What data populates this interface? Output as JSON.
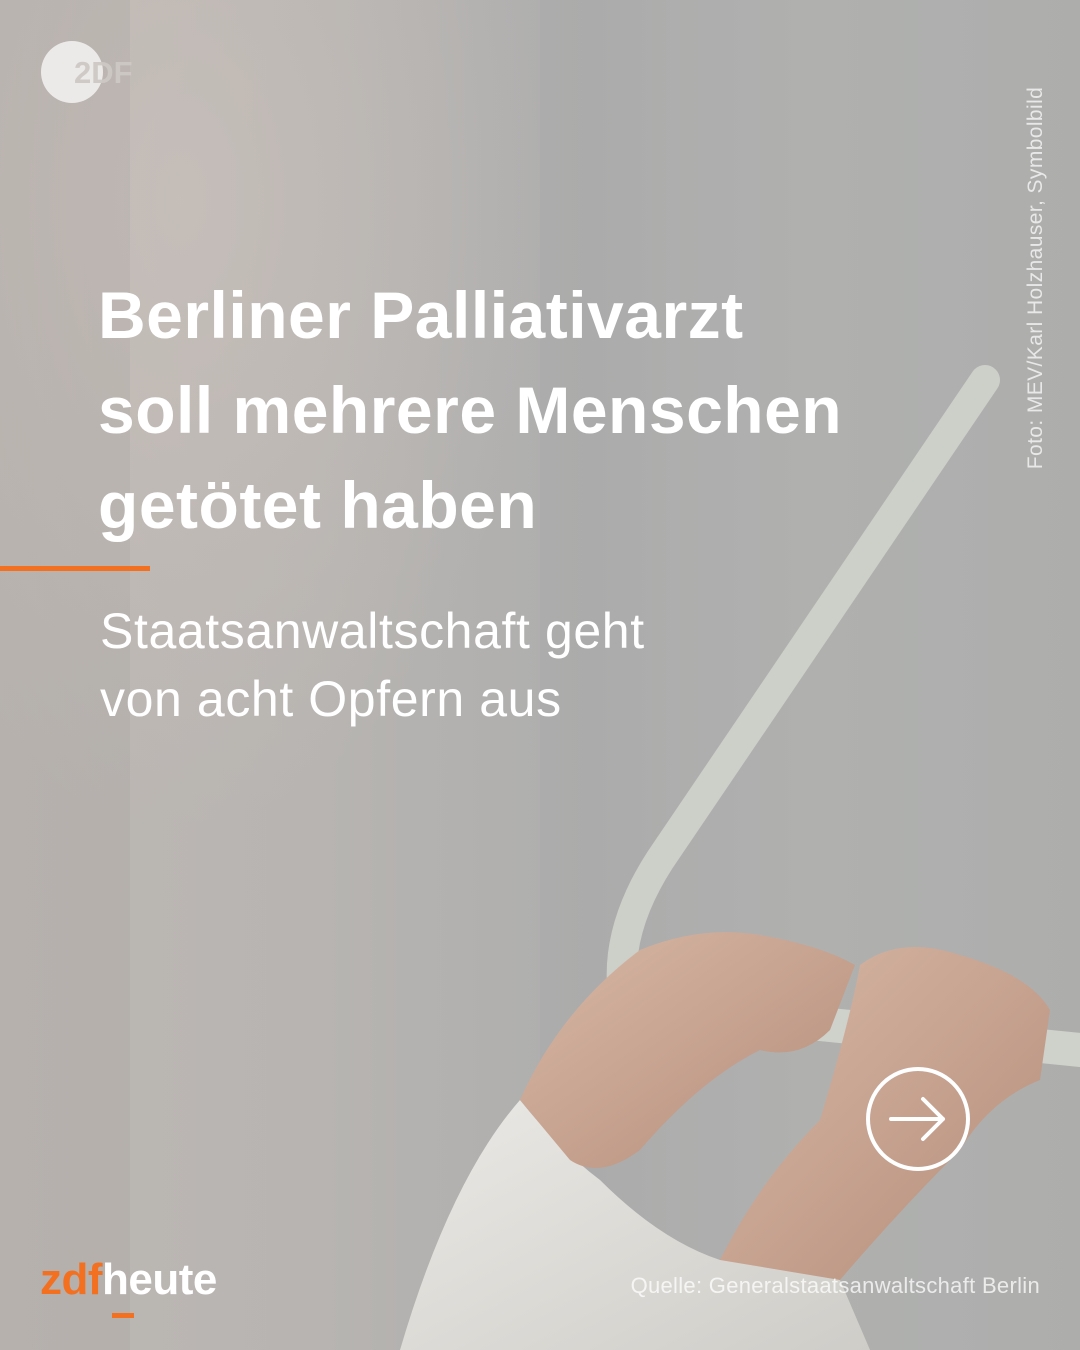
{
  "logo": {
    "text": "2DF"
  },
  "photo_credit": "Foto: MEV/Karl Holzhauser, Symbolbild",
  "headline": {
    "line1": "Berliner Palliativarzt",
    "line2": "soll mehrere Menschen",
    "line3": "getötet haben"
  },
  "subline": {
    "line1": "Staatsanwaltschaft geht",
    "line2": "von acht Opfern aus"
  },
  "brand": {
    "part1": "zdf",
    "part2": "heute"
  },
  "source": "Quelle: Generalstaatsanwaltschaft Berlin",
  "icons": {
    "next": "arrow-right-circle-icon"
  },
  "colors": {
    "accent": "#f37021",
    "text": "#ffffff"
  }
}
